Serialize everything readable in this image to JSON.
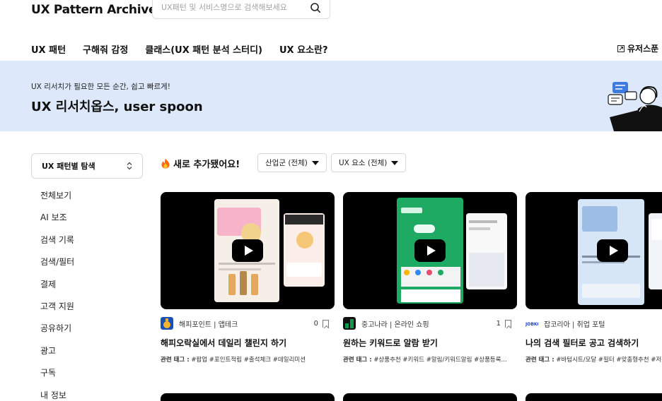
{
  "header": {
    "logo": "UX Pattern Archive",
    "search_placeholder": "UX패턴 및 서비스명으로 검색해보세요"
  },
  "nav": {
    "items": [
      "UX 패턴",
      "구해줘 감정",
      "클래스(UX 패턴 분석 스터디)",
      "UX 요소란?"
    ],
    "external": "유저스푼"
  },
  "banner": {
    "subtitle": "UX 리서치가 필요한 모든 순간, 쉽고 빠르게!",
    "title": "UX 리서치옵스, user spoon"
  },
  "sidebar": {
    "select_label": "UX 패턴별 탐색",
    "items": [
      "전체보기",
      "AI 보조",
      "검색 기록",
      "검색/필터",
      "결제",
      "고객 지원",
      "공유하기",
      "광고",
      "구독",
      "내 정보"
    ]
  },
  "main": {
    "section_title": "새로 추가됐어요!",
    "filters": [
      "산업군 (전체)",
      "UX 요소 (전체)"
    ],
    "tags_label": "관련 태그 :",
    "cards": [
      {
        "brand": "해피포인트 | 앱테크",
        "count": "0",
        "title": "해피오락실에서 데일리 챌린지 하기",
        "tags": "#팝업 #포인트적립 #출석체크 #데일리미션",
        "logo_color": "#1a4fb5"
      },
      {
        "brand": "중고나라 | 온라인 쇼핑",
        "count": "1",
        "title": "원하는 키워드로 알람 받기",
        "tags": "#상품추천 #키워드 #알림/키워드알림 #상품등록...",
        "logo_color": "#0f9a4e"
      },
      {
        "brand": "잡코리아 | 취업 포털",
        "count": "",
        "title": "나의 검색 필터로 공고 검색하기",
        "tags": "#바텀시트/모달 #필터 #맞춤형추천 #저장",
        "logo_color": "#1e3fd6"
      }
    ]
  },
  "icons": {
    "search": "search-icon",
    "chevron": "chevron-updown-icon",
    "fire": "fire-icon",
    "play": "play-icon",
    "bookmark": "bookmark-icon",
    "external": "external-link-icon"
  },
  "colors": {
    "banner_bg": "#dde9fb",
    "thumb_bg": "#000000"
  }
}
